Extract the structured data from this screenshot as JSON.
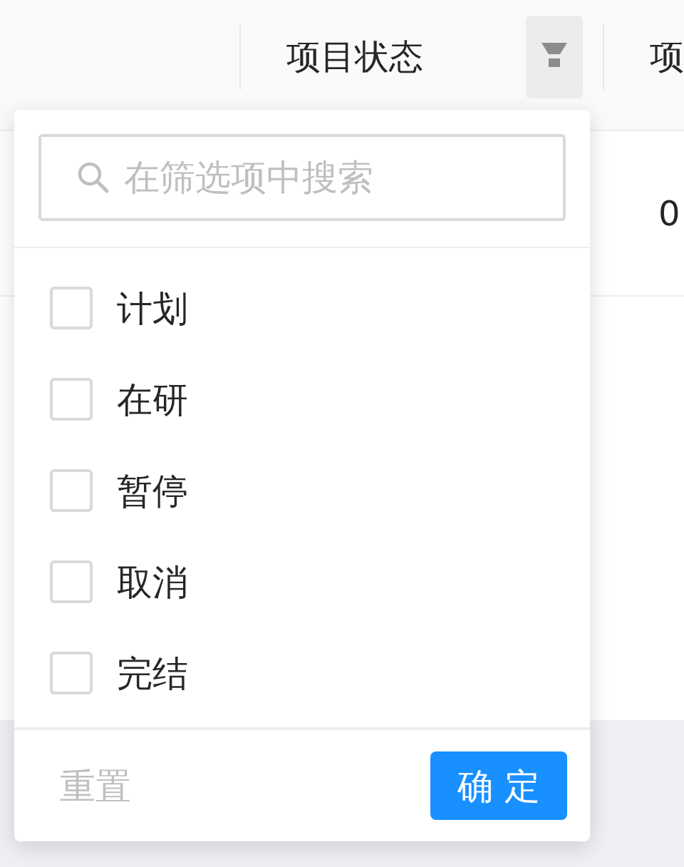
{
  "table": {
    "columns": [
      {
        "label": "项目状态",
        "filter": true
      },
      {
        "label": "项",
        "filter": false
      }
    ],
    "rows": [
      {
        "column_2": "0"
      }
    ]
  },
  "filter_dropdown": {
    "search": {
      "placeholder": "在筛选项中搜索"
    },
    "options": [
      {
        "label": "计划",
        "checked": false
      },
      {
        "label": "在研",
        "checked": false
      },
      {
        "label": "暂停",
        "checked": false
      },
      {
        "label": "取消",
        "checked": false
      },
      {
        "label": "完结",
        "checked": false
      }
    ],
    "reset_button": {
      "label": "重置",
      "disabled": true
    },
    "confirm_button": {
      "label": "确 定"
    }
  }
}
